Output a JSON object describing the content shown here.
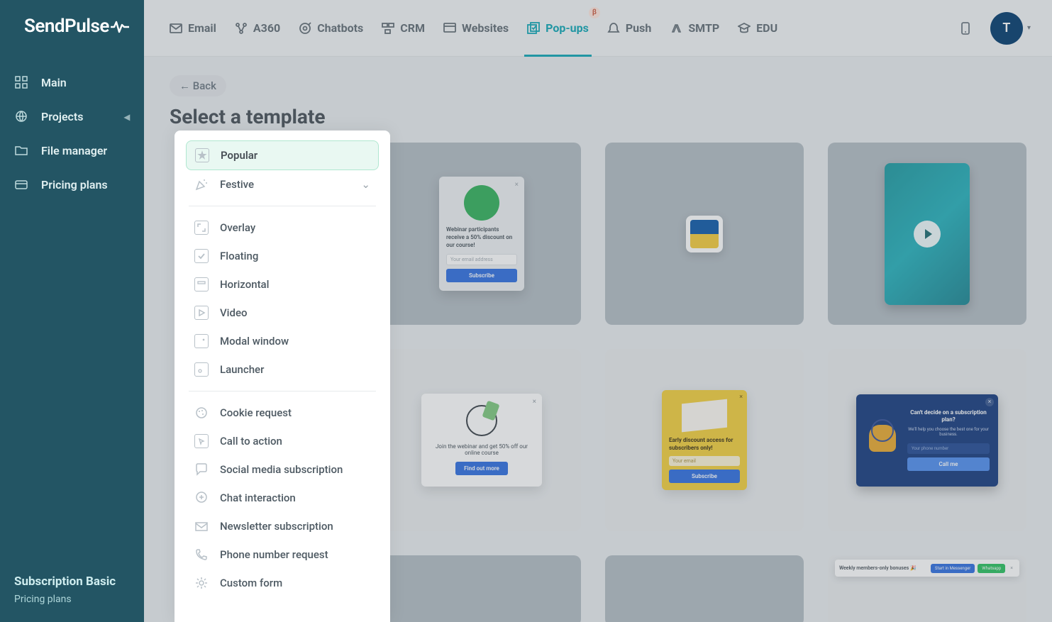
{
  "brand": "SendPulse",
  "topnav": [
    {
      "icon": "email-icon",
      "label": "Email"
    },
    {
      "icon": "a360-icon",
      "label": "A360"
    },
    {
      "icon": "chatbot-icon",
      "label": "Chatbots"
    },
    {
      "icon": "crm-icon",
      "label": "CRM"
    },
    {
      "icon": "websites-icon",
      "label": "Websites"
    },
    {
      "icon": "popups-icon",
      "label": "Pop-ups",
      "active": true,
      "badge": "β"
    },
    {
      "icon": "push-icon",
      "label": "Push"
    },
    {
      "icon": "smtp-icon",
      "label": "SMTP"
    },
    {
      "icon": "edu-icon",
      "label": "EDU"
    }
  ],
  "avatar_letter": "T",
  "sidebar": {
    "items": [
      {
        "icon": "grid-icon",
        "label": "Main"
      },
      {
        "icon": "globe-icon",
        "label": "Projects",
        "expandable": true
      },
      {
        "icon": "folder-icon",
        "label": "File manager"
      },
      {
        "icon": "card-icon",
        "label": "Pricing plans"
      }
    ],
    "footer_title": "Subscription Basic",
    "footer_sub": "Pricing plans"
  },
  "page": {
    "back_label": "← Back",
    "title": "Select a template"
  },
  "categories": {
    "group1": [
      {
        "label": "Popular",
        "icon": "star-icon",
        "active": true
      },
      {
        "label": "Festive",
        "icon": "confetti-icon",
        "expandable": true
      }
    ],
    "group2": [
      {
        "label": "Overlay",
        "icon": "expand-icon"
      },
      {
        "label": "Floating",
        "icon": "check-icon"
      },
      {
        "label": "Horizontal",
        "icon": "hbar-icon"
      },
      {
        "label": "Video",
        "icon": "play-icon"
      },
      {
        "label": "Modal window",
        "icon": "window-x-icon"
      },
      {
        "label": "Launcher",
        "icon": "dot-window-icon"
      }
    ],
    "group3": [
      {
        "label": "Cookie request",
        "icon": "cookie-icon"
      },
      {
        "label": "Call to action",
        "icon": "cta-icon"
      },
      {
        "label": "Social media subscription",
        "icon": "chat-icon"
      },
      {
        "label": "Chat interaction",
        "icon": "plus-chat-icon"
      },
      {
        "label": "Newsletter subscription",
        "icon": "envelope-icon"
      },
      {
        "label": "Phone number request",
        "icon": "phone-icon"
      },
      {
        "label": "Custom form",
        "icon": "gear-icon"
      }
    ]
  },
  "previews": {
    "webinar": {
      "text": "Webinar participants receive a 50% discount on our course!",
      "placeholder": "Your email address",
      "button": "Subscribe"
    },
    "find": {
      "text": "Join the webinar and get 50% off our online course",
      "button": "Find out more"
    },
    "yellow": {
      "text": "Early discount access for subscribers only!",
      "placeholder": "Your email",
      "button": "Subscribe"
    },
    "blue": {
      "text1": "Can't decide on a subscription plan?",
      "text2": "We'll help you choose the best one for your business.",
      "placeholder": "Your phone number",
      "button": "Call me"
    },
    "strip": {
      "text": "Weekly members-only bonuses 🎉",
      "btn1": "Start in Messenger",
      "btn2": "Whatsapp"
    }
  }
}
